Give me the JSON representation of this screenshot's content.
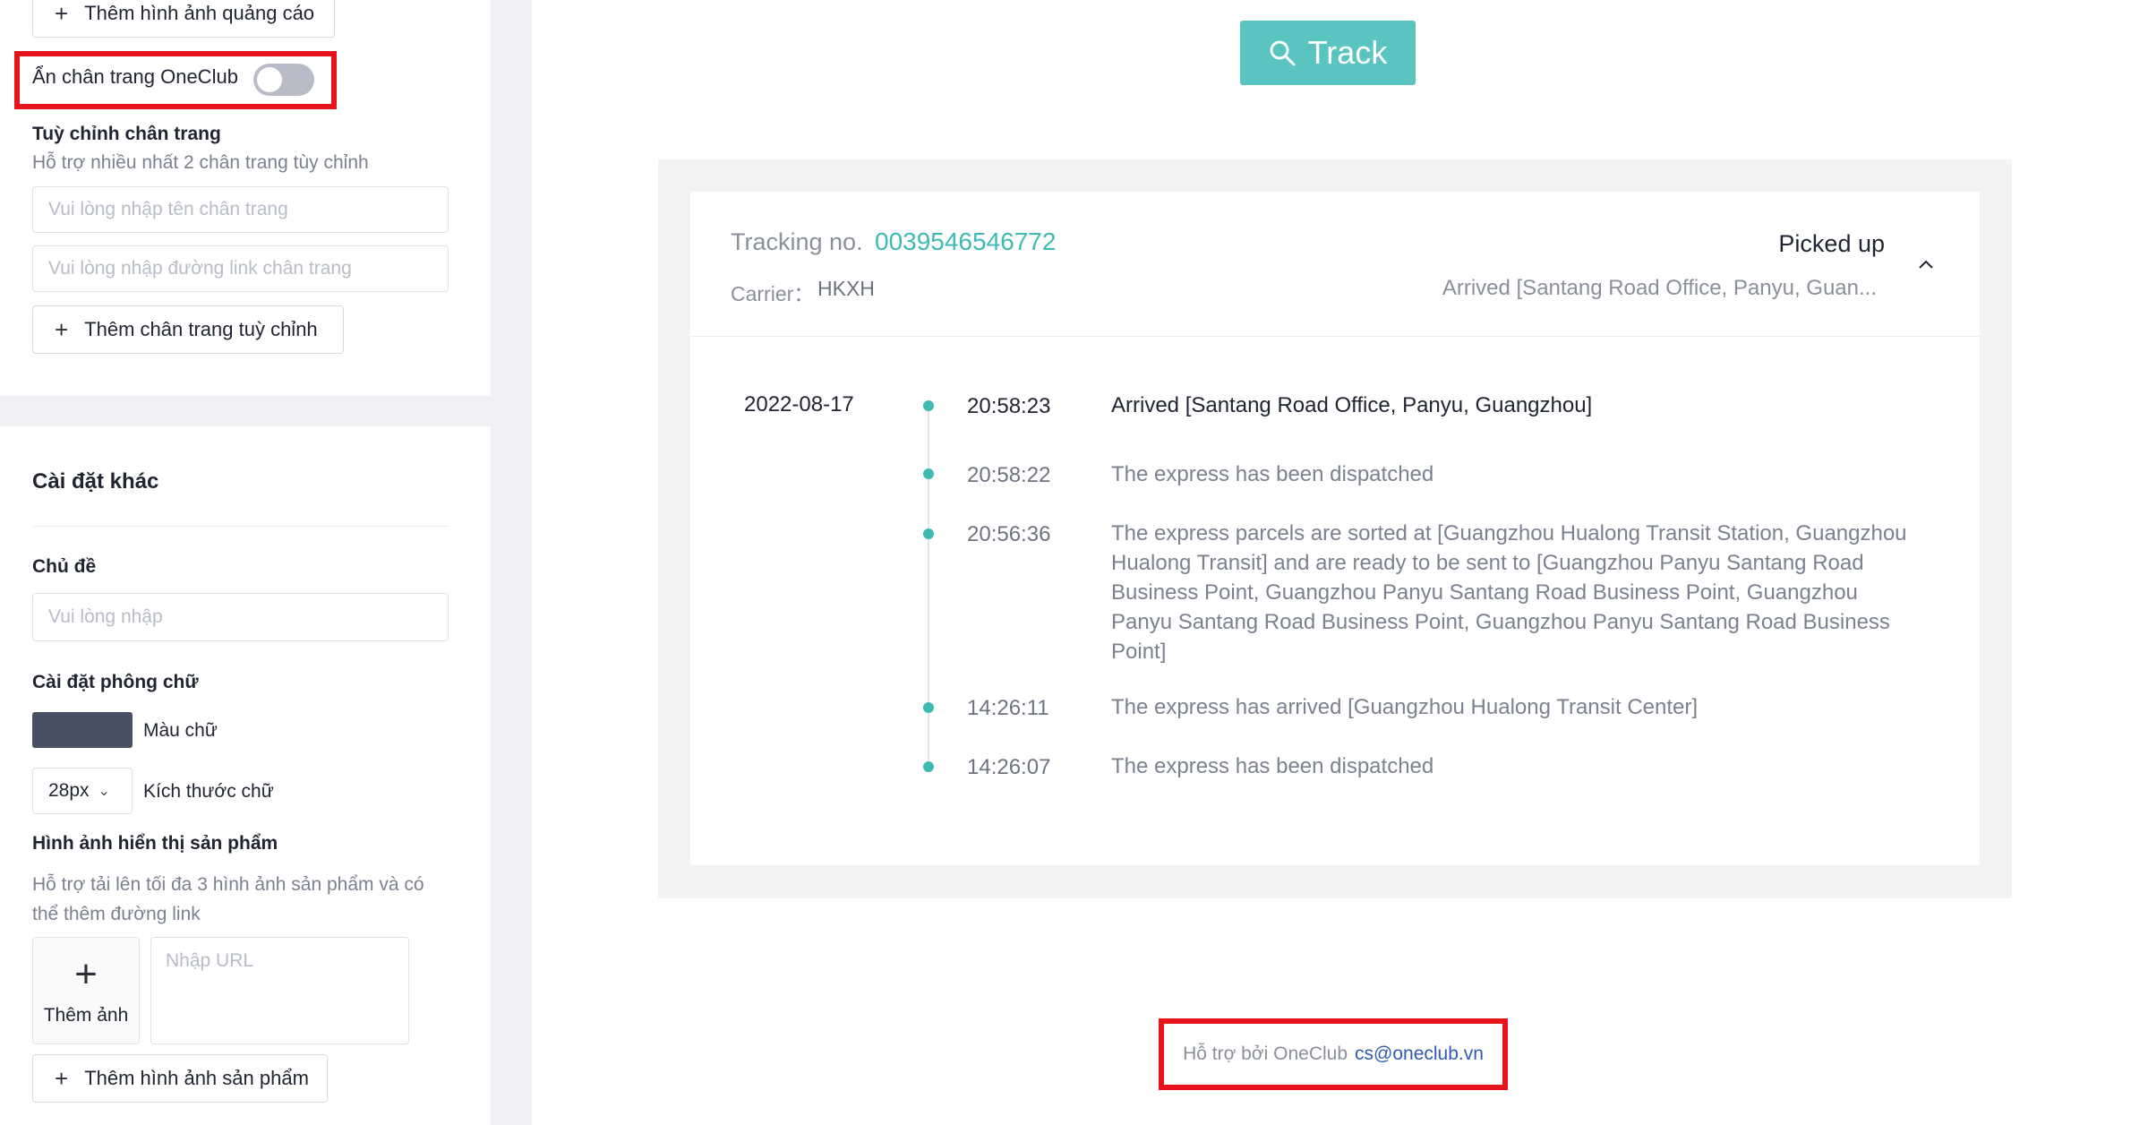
{
  "settings": {
    "add_ad_image_label": "Thêm hình ảnh quảng cáo",
    "hide_footer_label": "Ẩn chân trang OneClub",
    "hide_footer_enabled": false,
    "custom_footer_title": "Tuỳ chỉnh chân trang",
    "custom_footer_hint": "Hỗ trợ nhiều nhất 2 chân trang tùy chỉnh",
    "footer_name_placeholder": "Vui lòng nhập tên chân trang",
    "footer_link_placeholder": "Vui lòng nhập đường link chân trang",
    "add_custom_footer_label": "Thêm chân trang tuỳ chỉnh",
    "other_settings_title": "Cài đặt khác",
    "subject_label": "Chủ đề",
    "subject_placeholder": "Vui lòng nhập",
    "font_settings_label": "Cài đặt phông chữ",
    "font_color_label": "Màu chữ",
    "font_color": "#485163",
    "font_size_value": "28px",
    "font_size_label": "Kích thước chữ",
    "product_images_title": "Hình ảnh hiển thị sản phẩm",
    "product_images_hint": "Hỗ trợ tải lên tối đa 3 hình ảnh sản phẩm và có thể thêm đường link",
    "add_image_label": "Thêm ảnh",
    "url_placeholder": "Nhập URL",
    "add_product_image_label": "Thêm hình ảnh sản phẩm"
  },
  "preview": {
    "track_button_label": "Track",
    "accent_color": "#5ac4c0",
    "tracking_label": "Tracking no.",
    "tracking_number": "0039546546772",
    "carrier_label": "Carrier：",
    "carrier_value": "HKXH",
    "status": "Picked up",
    "last_event_summary": "Arrived [Santang Road Office, Panyu, Guan...",
    "date": "2022-08-17",
    "events": [
      {
        "time": "20:58:23",
        "description": "Arrived [Santang Road Office, Panyu, Guangzhou]"
      },
      {
        "time": "20:58:22",
        "description": "The express has been dispatched"
      },
      {
        "time": "20:56:36",
        "description": "The express parcels are sorted at [Guangzhou Hualong Transit Station, Guangzhou Hualong Transit] and are ready to be sent to [Guangzhou Panyu Santang Road Business Point, Guangzhou Panyu Santang Road Business Point, Guangzhou Panyu Santang Road Business Point, Guangzhou Panyu Santang Road Business Point]"
      },
      {
        "time": "14:26:11",
        "description": "The express has arrived [Guangzhou Hualong Transit Center]"
      },
      {
        "time": "14:26:07",
        "description": "The express has been dispatched"
      }
    ],
    "footer_supported_by": "Hỗ trợ bởi OneClub",
    "footer_email": "cs@oneclub.vn"
  }
}
